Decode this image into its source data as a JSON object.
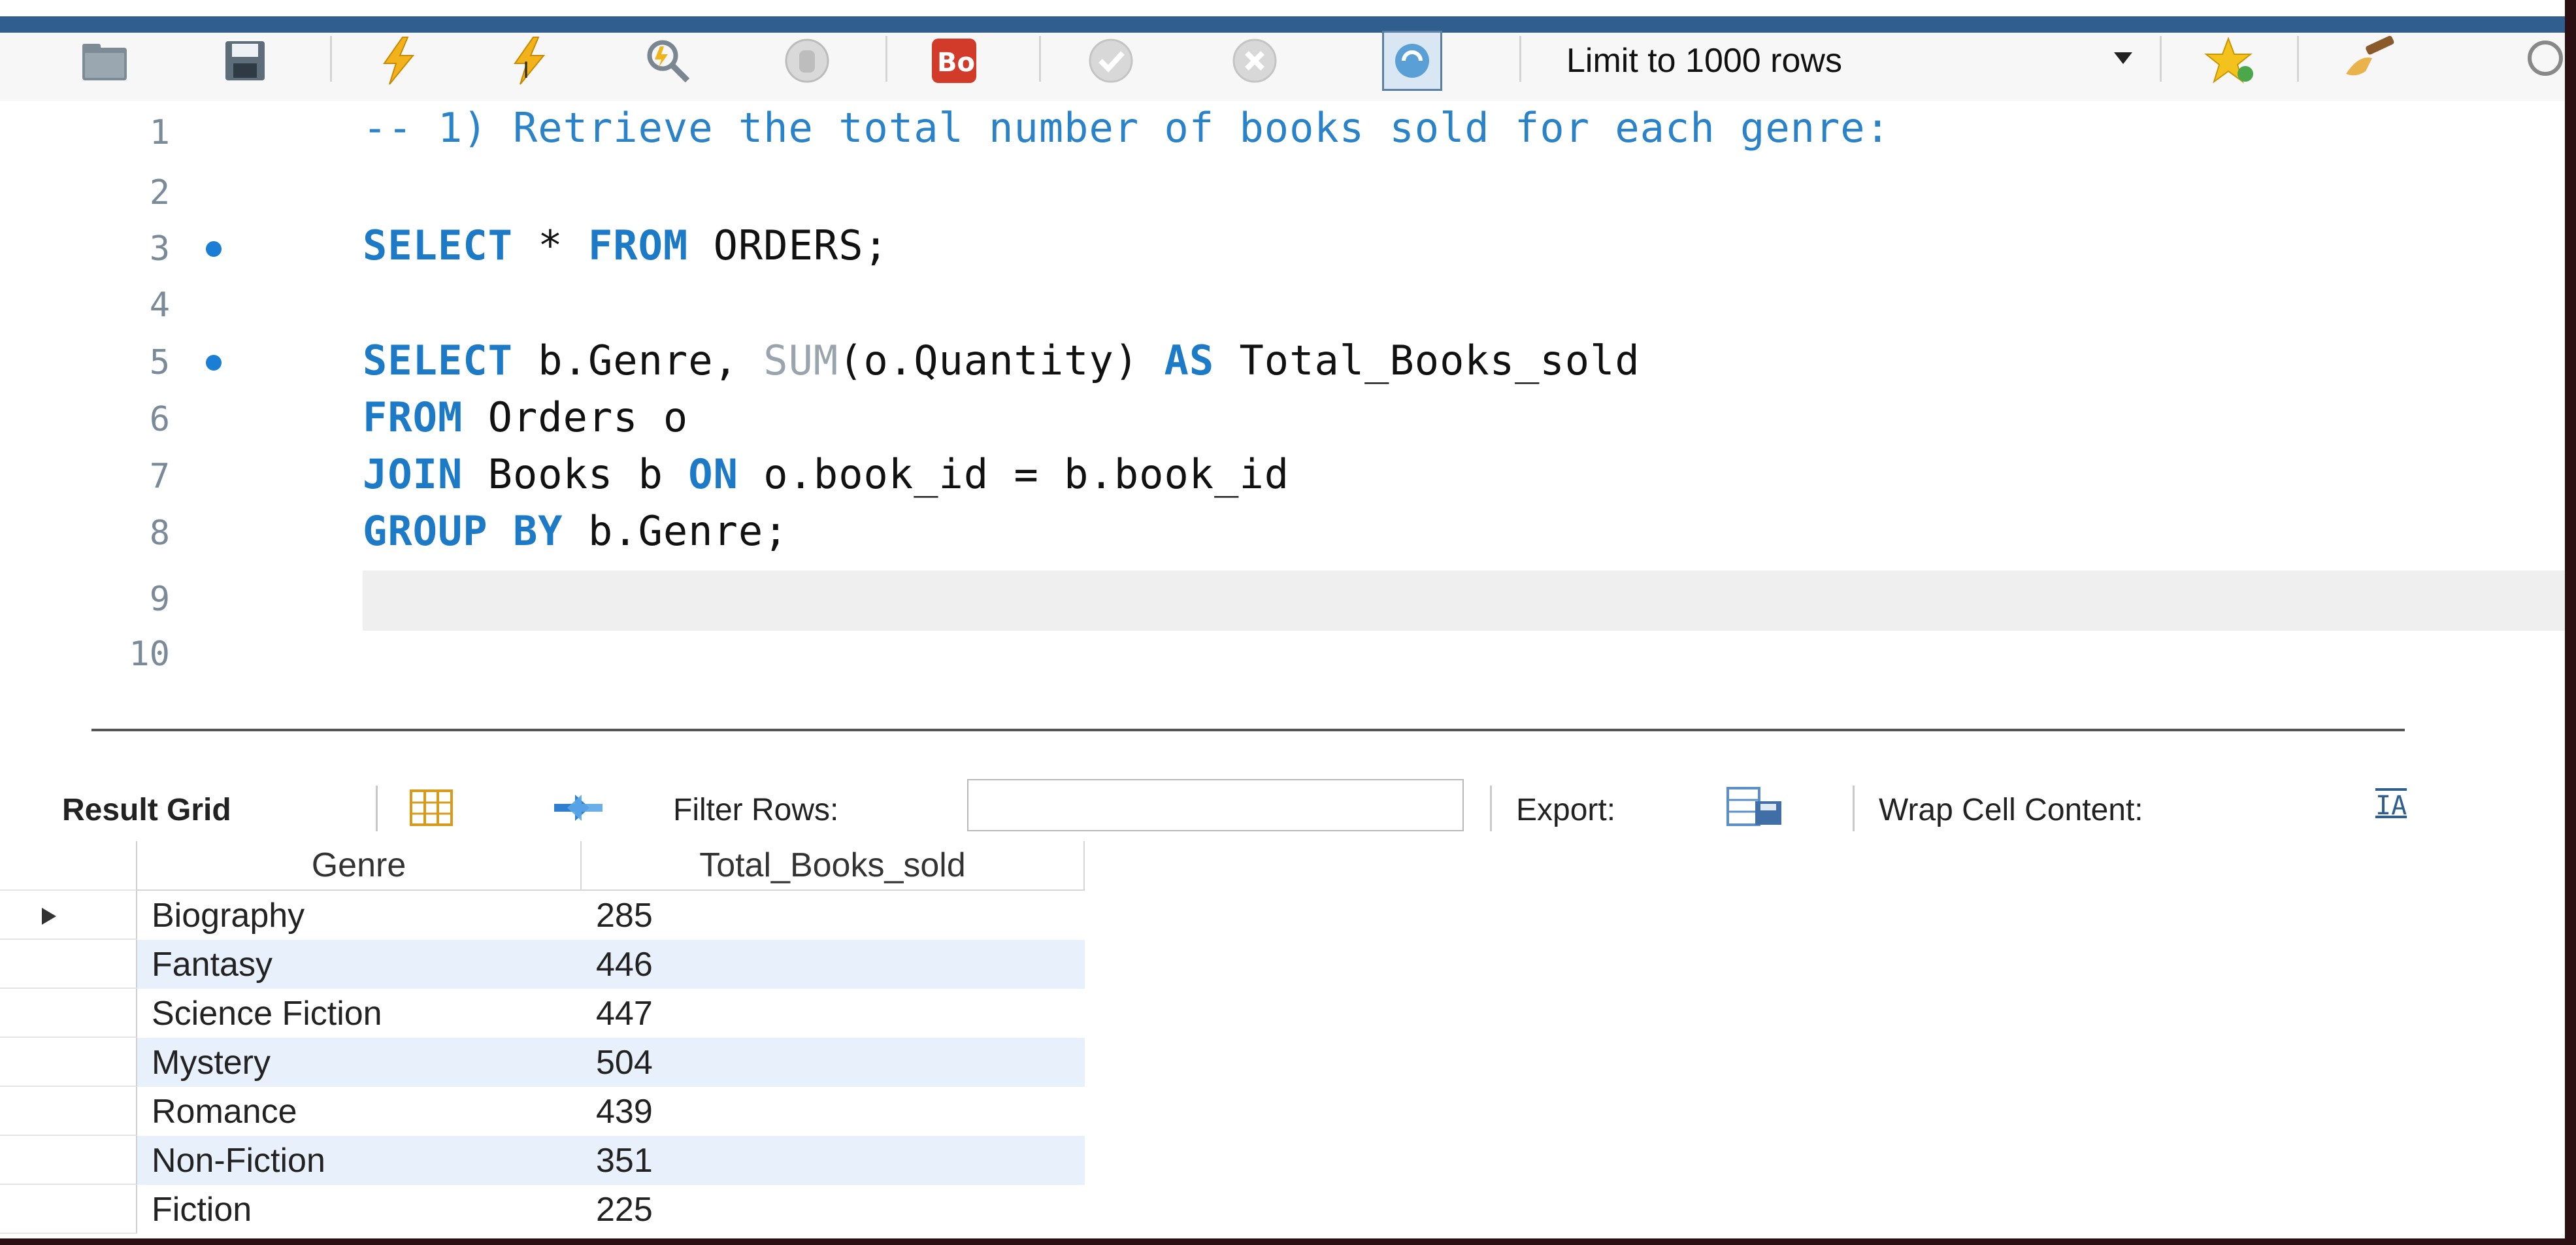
{
  "toolbar": {
    "limit_label": "Limit to 1000 rows"
  },
  "editor": {
    "lines": [
      {
        "num": "1"
      },
      {
        "num": "2"
      },
      {
        "num": "3"
      },
      {
        "num": "4"
      },
      {
        "num": "5"
      },
      {
        "num": "6"
      },
      {
        "num": "7"
      },
      {
        "num": "8"
      },
      {
        "num": "9"
      },
      {
        "num": "10"
      }
    ],
    "line1_comment": "-- 1) Retrieve the total number of books sold for each genre:",
    "line3": {
      "kw1": "SELECT",
      "star": " * ",
      "kw2": "FROM",
      "rest": " ORDERS;"
    },
    "line5": {
      "kw1": "SELECT",
      "a": " b.Genre, ",
      "fn": "SUM",
      "b": "(o.Quantity) ",
      "kw2": "AS",
      "c": " Total_Books_sold"
    },
    "line6": {
      "kw": "FROM",
      "rest": " Orders o"
    },
    "line7": {
      "kw1": "JOIN",
      "a": " Books b ",
      "kw2": "ON",
      "b": " o.book_id = b.book_id"
    },
    "line8": {
      "kw": "GROUP BY",
      "rest": " b.Genre;"
    }
  },
  "result_toolbar": {
    "result_grid": "Result Grid",
    "filter_rows": "Filter Rows:",
    "filter_value": "",
    "export": "Export:",
    "wrap": "Wrap Cell Content:",
    "wrap_icon_text": "IA"
  },
  "grid": {
    "columns": [
      "Genre",
      "Total_Books_sold"
    ],
    "rows": [
      [
        "Biography",
        "285"
      ],
      [
        "Fantasy",
        "446"
      ],
      [
        "Science Fiction",
        "447"
      ],
      [
        "Mystery",
        "504"
      ],
      [
        "Romance",
        "439"
      ],
      [
        "Non-Fiction",
        "351"
      ],
      [
        "Fiction",
        "225"
      ]
    ]
  },
  "colors": {
    "keyword": "#1d7ac7",
    "comment": "#2a82c9",
    "function": "#9aa4ac",
    "breakpoint_dot": "#1a7fd4",
    "alt_row": "#e8f1fb"
  }
}
